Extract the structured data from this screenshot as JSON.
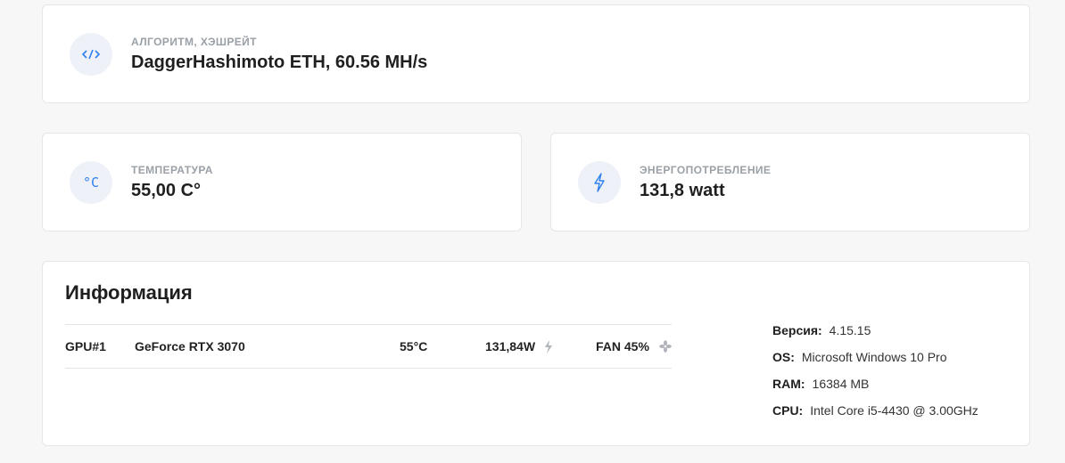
{
  "algorithm": {
    "label": "АЛГОРИТМ, ХЭШРЕЙТ",
    "value": "DaggerHashimoto ETH, 60.56 MH/s",
    "icon": "code-icon"
  },
  "temperature": {
    "label": "ТЕМПЕРАТУРА",
    "value": "55,00 C°",
    "icon": "celsius-icon",
    "icon_text": "°C"
  },
  "power": {
    "label": "ЭНЕРГОПОТРЕБЛЕНИЕ",
    "value": "131,8 watt",
    "icon": "lightning-icon"
  },
  "info": {
    "title": "Информация",
    "gpu": {
      "id": "GPU#1",
      "name": "GeForce RTX 3070",
      "temp": "55°C",
      "power": "131,84W",
      "fan": "FAN 45%"
    },
    "system": [
      {
        "key": "Версия:",
        "value": "4.15.15"
      },
      {
        "key": "OS:",
        "value": "Microsoft Windows 10 Pro"
      },
      {
        "key": "RAM:",
        "value": "16384 MB"
      },
      {
        "key": "CPU:",
        "value": "Intel Core i5-4430 @ 3.00GHz"
      }
    ]
  },
  "colors": {
    "accent": "#2f80ed",
    "icon_bg": "#eef1f8",
    "label": "#9aa0a6"
  }
}
